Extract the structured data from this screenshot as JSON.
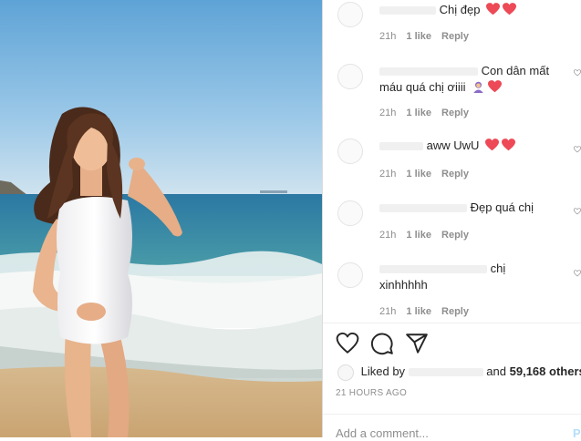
{
  "post": {
    "timestamp": "21 HOURS AGO",
    "liked_by_prefix": "Liked by",
    "liked_by_and": "and",
    "likes_count": "59,168 others",
    "add_comment_placeholder": "Add a comment...",
    "post_label": "P"
  },
  "comments": [
    {
      "lines": [
        "Chị đẹp"
      ],
      "emoji": [
        "heart",
        "heart"
      ],
      "time": "21h",
      "likes": "1 like",
      "reply": "Reply"
    },
    {
      "lines": [
        "Con dân mất",
        "máu quá chị ơiiii"
      ],
      "emoji": [
        "person",
        "heart"
      ],
      "time": "21h",
      "likes": "1 like",
      "reply": "Reply"
    },
    {
      "lines": [
        "aww UwU"
      ],
      "emoji": [
        "heart",
        "heart"
      ],
      "time": "21h",
      "likes": "1 like",
      "reply": "Reply"
    },
    {
      "lines": [
        "Đẹp quá chị"
      ],
      "emoji": [],
      "time": "21h",
      "likes": "1 like",
      "reply": "Reply"
    },
    {
      "lines": [
        "chị",
        "xinhhhhh"
      ],
      "emoji": [],
      "time": "21h",
      "likes": "1 like",
      "reply": "Reply"
    }
  ],
  "colors": {
    "heart": "#ed4956",
    "muted": "#8e8e8e",
    "text": "#262626",
    "divider": "#dbdbdb",
    "post_button": "#b2dffc"
  },
  "icons": [
    "heart-icon",
    "comment-icon",
    "share-icon",
    "small-heart-icon"
  ]
}
